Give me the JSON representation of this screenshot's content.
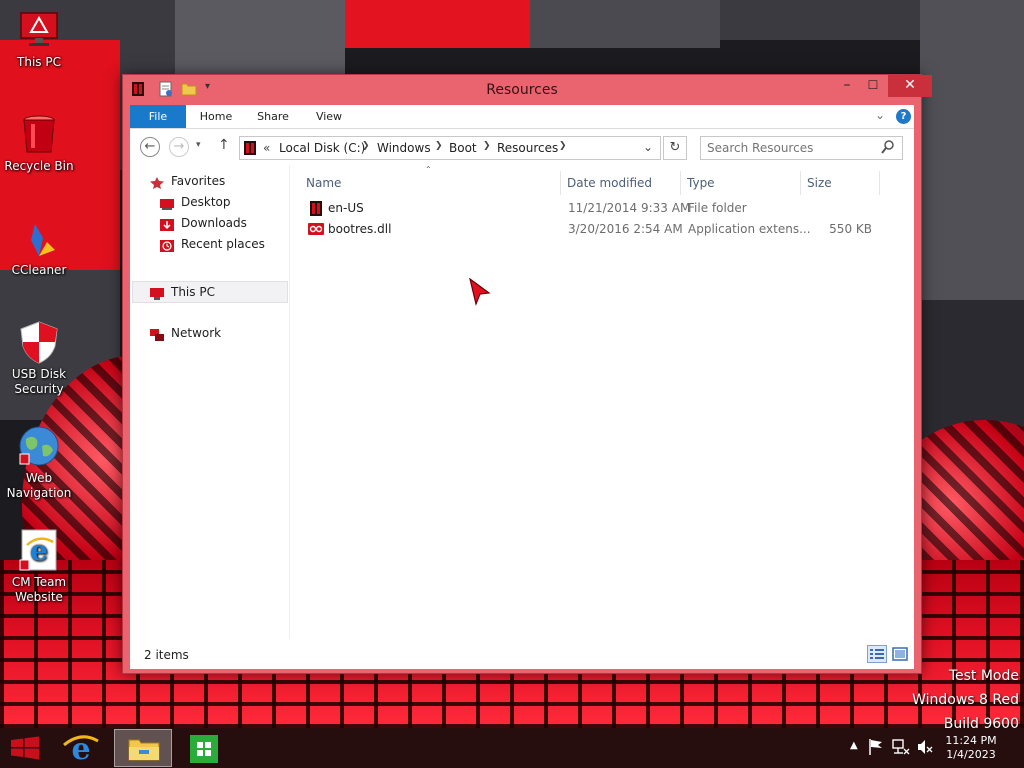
{
  "desktop": {
    "icons": [
      {
        "label": "This PC"
      },
      {
        "label": "Recycle Bin"
      },
      {
        "label": "CCleaner"
      },
      {
        "label": "USB Disk\nSecurity"
      },
      {
        "label": "Web\nNavigation"
      },
      {
        "label": "CM Team\nWebsite"
      }
    ],
    "watermark": [
      "Test Mode",
      "Windows 8 Red",
      "Build 9600"
    ]
  },
  "window": {
    "title": "Resources",
    "controls": {
      "minimize": "–",
      "maximize": "☐",
      "close": "✕"
    },
    "ribbon": {
      "tabs": [
        "File",
        "Home",
        "Share",
        "View"
      ],
      "help": "?"
    },
    "address": {
      "overflow": "«",
      "crumbs": [
        "Local Disk (C:)",
        "Windows",
        "Boot",
        "Resources"
      ]
    },
    "search": {
      "placeholder": "Search Resources"
    },
    "nav": {
      "favorites": "Favorites",
      "favorite_items": [
        "Desktop",
        "Downloads",
        "Recent places"
      ],
      "this_pc": "This PC",
      "network": "Network"
    },
    "columns": [
      "Name",
      "Date modified",
      "Type",
      "Size"
    ],
    "files": [
      {
        "name": "en-US",
        "date": "11/21/2014 9:33 AM",
        "type": "File folder",
        "size": ""
      },
      {
        "name": "bootres.dll",
        "date": "3/20/2016 2:54 AM",
        "type": "Application extens...",
        "size": "550 KB"
      }
    ],
    "status": "2 items"
  },
  "taskbar": {
    "clock_time": "11:24 PM",
    "clock_date": "1/4/2023"
  },
  "colors": {
    "window_frame": "#ea6470",
    "ribbon_file_tab": "#1979ca",
    "selection": "#f2f2f4",
    "accent_red": "#d4101e"
  }
}
